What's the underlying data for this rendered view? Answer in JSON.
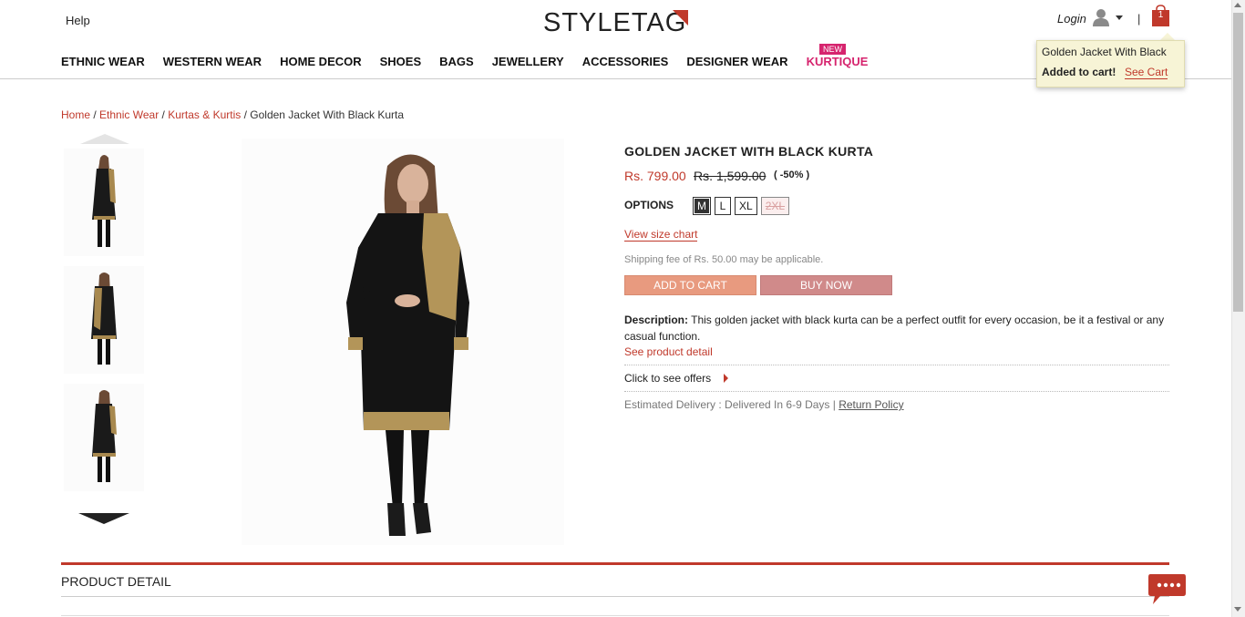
{
  "header": {
    "help": "Help",
    "logo": "STYLETAG",
    "login": "Login",
    "separator": "|",
    "cart_count": "1"
  },
  "nav": {
    "items": [
      "ETHNIC WEAR",
      "WESTERN WEAR",
      "HOME DECOR",
      "SHOES",
      "BAGS",
      "JEWELLERY",
      "ACCESSORIES",
      "DESIGNER WEAR",
      "KURTIQUE"
    ],
    "new_badge": "NEW"
  },
  "cart_popup": {
    "product": "Golden Jacket With Black",
    "added": "Added to cart!",
    "see_cart": "See Cart"
  },
  "breadcrumb": {
    "home": "Home",
    "cat": "Ethnic Wear",
    "sub": "Kurtas & Kurtis",
    "sep": "/",
    "current": "Golden Jacket With Black Kurta"
  },
  "product": {
    "title": "GOLDEN JACKET WITH BLACK KURTA",
    "price": "Rs. 799.00",
    "mrp": "Rs. 1,599.00",
    "discount": "( -50% )",
    "options_label": "OPTIONS",
    "sizes": [
      "M",
      "L",
      "XL",
      "2XL"
    ],
    "selected_size": "M",
    "size_chart": "View size chart",
    "shipping": "Shipping fee of Rs. 50.00 may be applicable.",
    "add_to_cart": "ADD TO CART",
    "buy_now": "BUY NOW",
    "description_label": "Description:",
    "description": "This golden jacket with black kurta can be a perfect outfit for every occasion, be it a festival or any casual function.",
    "see_detail": "See product detail",
    "offers": "Click to see offers",
    "delivery": "Estimated Delivery : Delivered In 6-9 Days | ",
    "return_policy": "Return Policy"
  },
  "detail": {
    "title": "PRODUCT DETAIL"
  },
  "colors": {
    "accent": "#c0392b",
    "kurtique": "#d6246e",
    "popup_bg": "#f7f4d6"
  },
  "icons": [
    "user-icon",
    "caret-down-icon",
    "shopping-bag-icon",
    "chevron-up-icon",
    "chevron-down-icon",
    "play-arrow-icon",
    "chat-bubble-icon"
  ]
}
